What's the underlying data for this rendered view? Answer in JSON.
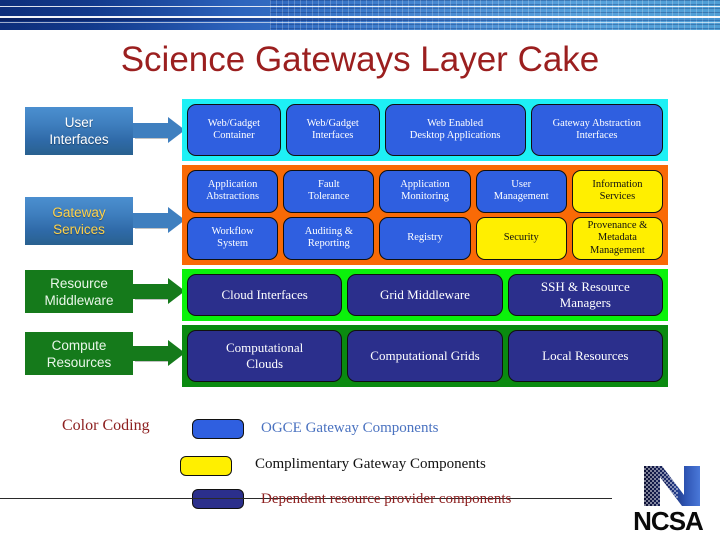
{
  "slide": {
    "title": "Science Gateways Layer Cake"
  },
  "colors": {
    "title_red": "#9b1f1f",
    "band_cyan": "#1ef0f5",
    "band_orange": "#f96a06",
    "band_light_green": "#0bf20b",
    "band_dark_green": "#0a8a10",
    "component_blue": "#2f5fe0",
    "component_yellow": "#ffef00",
    "component_navy": "#2b2f8c",
    "label_blue": "#3f7fbf",
    "label_green": "#157a1b"
  },
  "layers": [
    {
      "label": "User\nInterfaces",
      "label_line1": "User",
      "label_line2": "Interfaces",
      "label_style": "blue",
      "band_color": "#1ef0f5",
      "rows": [
        [
          {
            "text": "Web/Gadget\nContainer",
            "line1": "Web/Gadget",
            "line2": "Container",
            "color": "blue",
            "flex": 1
          },
          {
            "text": "Web/Gadget\nInterfaces",
            "line1": "Web/Gadget",
            "line2": "Interfaces",
            "color": "blue",
            "flex": 1
          },
          {
            "text": "Web Enabled\nDesktop Applications",
            "line1": "Web Enabled",
            "line2": "Desktop Applications",
            "color": "blue",
            "flex": 1.55
          },
          {
            "text": "Gateway Abstraction\nInterfaces",
            "line1": "Gateway Abstraction",
            "line2": "Interfaces",
            "color": "blue",
            "flex": 1.45
          }
        ]
      ]
    },
    {
      "label": "Gateway\nServices",
      "label_line1": "Gateway",
      "label_line2": "Services",
      "label_style": "blue-accent",
      "band_color": "#f96a06",
      "rows": [
        [
          {
            "line1": "Application",
            "line2": "Abstractions",
            "color": "blue",
            "flex": 1
          },
          {
            "line1": "Fault",
            "line2": "Tolerance",
            "color": "blue",
            "flex": 1
          },
          {
            "line1": "Application",
            "line2": "Monitoring",
            "color": "blue",
            "flex": 1
          },
          {
            "line1": "User",
            "line2": "Management",
            "color": "blue",
            "flex": 1
          },
          {
            "line1": "Information",
            "line2": "Services",
            "color": "yellow",
            "flex": 1
          }
        ],
        [
          {
            "line1": "Workflow",
            "line2": "System",
            "color": "blue",
            "flex": 1
          },
          {
            "line1": "Auditing &",
            "line2": "Reporting",
            "color": "blue",
            "flex": 1
          },
          {
            "line1": "Registry",
            "line2": "",
            "color": "blue",
            "flex": 1
          },
          {
            "line1": "Security",
            "line2": "",
            "color": "yellow",
            "flex": 1
          },
          {
            "line1": "Provenance &",
            "line2": "Metadata",
            "line3": "Management",
            "color": "yellow",
            "flex": 1
          }
        ]
      ]
    },
    {
      "label": "Resource\nMiddleware",
      "label_line1": "Resource",
      "label_line2": "Middleware",
      "label_style": "green",
      "band_color": "#0bf20b",
      "rows": [
        [
          {
            "line1": "Cloud Interfaces",
            "line2": "",
            "color": "navy",
            "flex": 1,
            "big": true
          },
          {
            "line1": "Grid Middleware",
            "line2": "",
            "color": "navy",
            "flex": 1,
            "big": true
          },
          {
            "line1": "SSH & Resource",
            "line2": "Managers",
            "color": "navy",
            "flex": 1,
            "big": true
          }
        ]
      ]
    },
    {
      "label": "Compute\nResources",
      "label_line1": "Compute",
      "label_line2": "Resources",
      "label_style": "green",
      "band_color": "#0a8a10",
      "rows": [
        [
          {
            "line1": "Computational",
            "line2": "Clouds",
            "color": "navy",
            "flex": 1,
            "big": true
          },
          {
            "line1": "Computational Grids",
            "line2": "",
            "color": "navy",
            "flex": 1,
            "big": true
          },
          {
            "line1": "Local Resources",
            "line2": "",
            "color": "navy",
            "flex": 1,
            "big": true
          }
        ]
      ]
    }
  ],
  "legend": {
    "title": "Color Coding",
    "entries": [
      {
        "swatch": "#2f5fe0",
        "swatch_class": "sw-blue",
        "label": "OGCE Gateway Components",
        "text_class": "lt-blue"
      },
      {
        "swatch": "#ffef00",
        "swatch_class": "sw-yellow",
        "label": "Complimentary Gateway Components",
        "text_class": "lt-black"
      },
      {
        "swatch": "#2b2f8c",
        "swatch_class": "sw-navy",
        "label": "Dependent resource provider components",
        "text_class": "lt-red"
      }
    ]
  },
  "logo": {
    "name": "NCSA",
    "text": "NCSA"
  }
}
